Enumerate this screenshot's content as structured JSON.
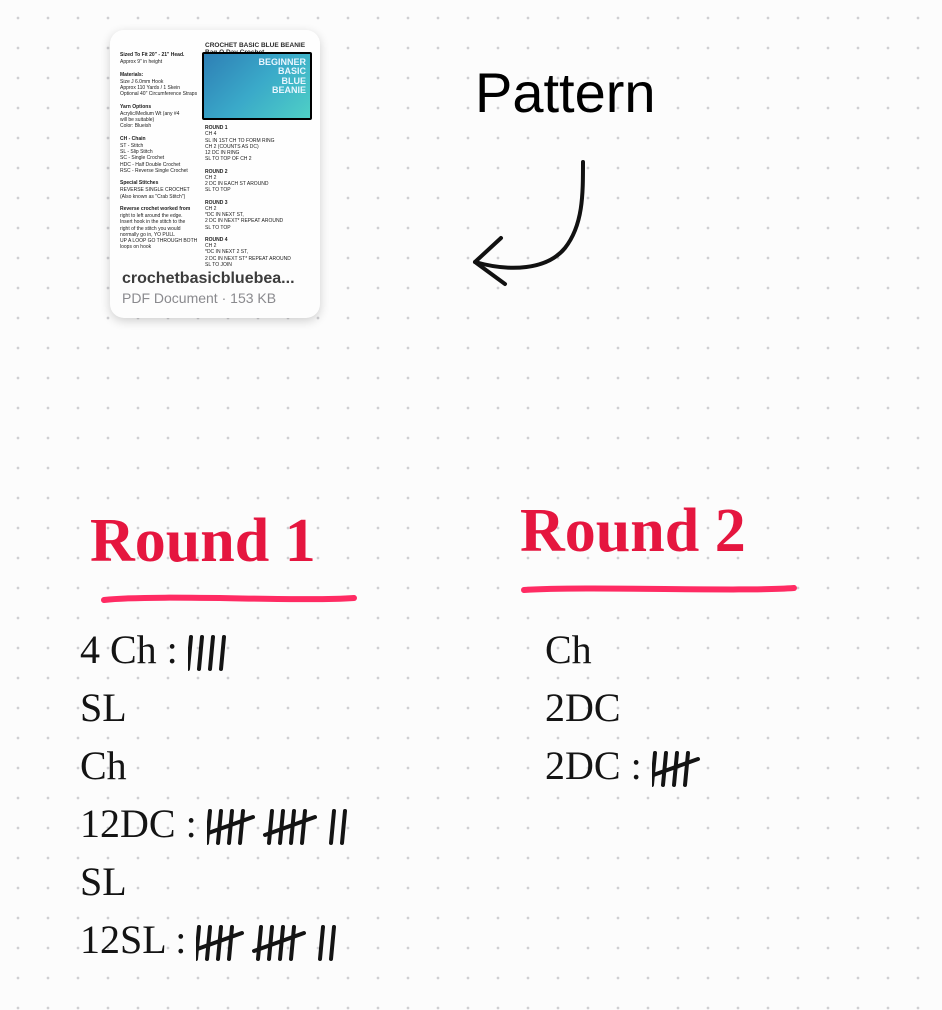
{
  "attachment": {
    "filename_display": "crochetbasicbluebea...",
    "file_type": "PDF Document",
    "file_size": "153 KB",
    "doc_title": "CROCHET BASIC BLUE BEANIE Bag O Day Crochet",
    "hero_words": [
      "BEGINNER",
      "BASIC",
      "BLUE",
      "BEANIE"
    ],
    "left_blocks": [
      "Sized To Fit 20\" - 21\" Head.\nApprox 9\" in height",
      "Materials:\nSize J 6.0mm Hook\nApprox 110 Yards / 1 Skein\nOptional 40\" Circumference Straps",
      "Yarn Options\nAcrylic/Medium Wt (any #4\nwill be suitable)\nColor: Blueish",
      "CH - Chain\nST - Stitch\nSL - Slip Stitch\nSC - Single Crochet\nHDC - Half Double Crochet\nRSC - Reverse Single Crochet",
      "Special Stitches\nREVERSE SINGLE CROCHET\n(Also known as \"Crab Stitch\")",
      "Reverse crochet worked from\nright to left around the edge.\nInsert hook in the stitch to the\nright of the stitch you would\nnormally go in, YO PULL\nUP A LOOP GO THROUGH BOTH\nloops on hook"
    ],
    "right_blocks": [
      "ROUND 1\nCH 4\nSL IN 1ST CH TO FORM RING\nCH 2 (COUNTS AS DC)\n12 DC IN RING\nSL TO TOP OF CH 2",
      "ROUND 2\nCH 2\n2 DC IN EACH ST AROUND\nSL TO TOP",
      "ROUND 3\nCH 2\n*DC IN NEXT ST,\n2 DC IN NEXT* REPEAT AROUND\nSL TO TOP",
      "ROUND 4\nCH 2\n*DC IN NEXT 2 ST,\n2 DC IN NEXT ST* REPEAT AROUND\nSL TO JOIN"
    ]
  },
  "label": "Pattern",
  "round1": {
    "title": "Round 1",
    "lines": [
      {
        "text": "4 Ch :",
        "tally": 4
      },
      {
        "text": "SL"
      },
      {
        "text": "Ch"
      },
      {
        "text": "12DC :",
        "tally": 12
      },
      {
        "text": "SL"
      },
      {
        "text": "12SL :",
        "tally": 12
      }
    ]
  },
  "round2": {
    "title": "Round 2",
    "lines": [
      {
        "text": "Ch"
      },
      {
        "text": "2DC"
      },
      {
        "text": "2DC :",
        "tally": 5
      }
    ]
  }
}
